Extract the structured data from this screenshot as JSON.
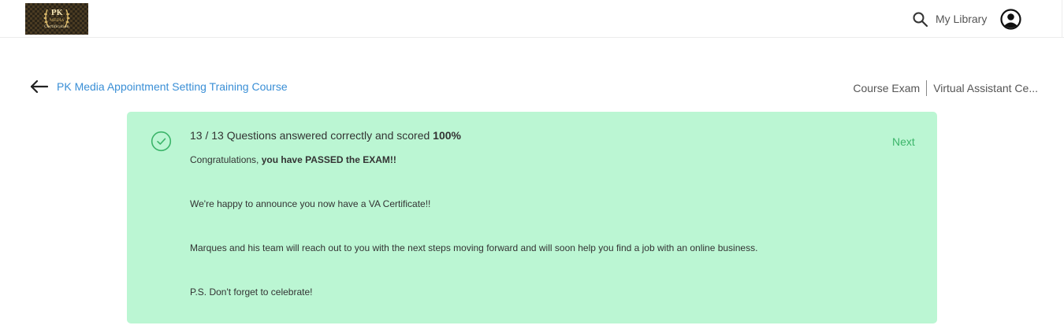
{
  "header": {
    "logo": {
      "mark": "PK",
      "line1": "MEDIA",
      "line2": "Certification",
      "colors": {
        "background": "#2b2418",
        "gold": "#d9b86a"
      }
    },
    "search_icon": "search-icon",
    "my_library_label": "My Library",
    "avatar_icon": "user-circle-icon"
  },
  "navigation": {
    "back_icon": "arrow-left-icon",
    "course_title": "PK Media Appointment Setting Training Course",
    "breadcrumbs": [
      "Course Exam",
      "Virtual Assistant Ce..."
    ]
  },
  "result": {
    "status_icon": "check-circle-icon",
    "score_prefix": "13 / 13 Questions answered correctly and scored ",
    "score_value": "100%",
    "next_label": "Next",
    "congrats_prefix": "Congratulations, ",
    "congrats_bold": "you have PASSED the EXAM!!",
    "line_2": "We're happy to announce you now have a VA Certificate!!",
    "line_3": "Marques and his team will reach out to you with the next steps moving forward and will soon help you find a job with an online business.",
    "line_4": "P.S. Don't forget to celebrate!",
    "colors": {
      "card_background": "#bbf6d3",
      "accent_green": "#3cb56a",
      "link_blue": "#3a8fd6"
    }
  }
}
